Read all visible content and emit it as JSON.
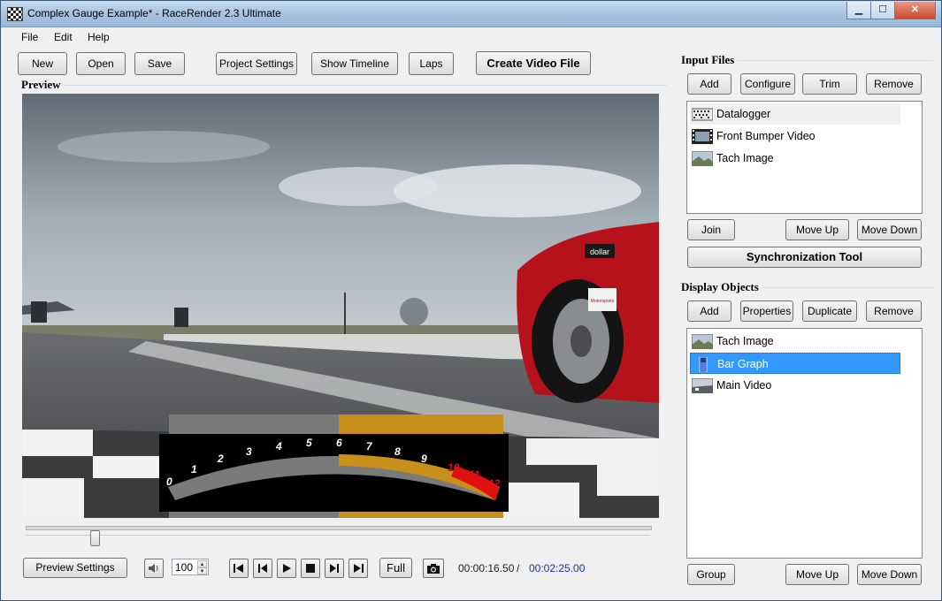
{
  "window": {
    "title": "Complex Gauge Example* - RaceRender 2.3 Ultimate",
    "minimize": "▁",
    "maximize": "☐",
    "close": "✕"
  },
  "menu": [
    "File",
    "Edit",
    "Help"
  ],
  "toolbar": {
    "new": "New",
    "open": "Open",
    "save": "Save",
    "project_settings": "Project Settings",
    "show_timeline": "Show Timeline",
    "laps": "Laps",
    "create_video": "Create Video File"
  },
  "preview": {
    "label": "Preview",
    "car_decal_1": "dollar",
    "car_decal_2": "Motorsports",
    "gauge_labels": [
      "0",
      "1",
      "2",
      "3",
      "4",
      "5",
      "6",
      "7",
      "8",
      "9",
      "10",
      "11",
      "12"
    ],
    "gauge_value_fraction": 0.52
  },
  "input_files": {
    "label": "Input Files",
    "buttons": {
      "add": "Add",
      "configure": "Configure",
      "trim": "Trim",
      "remove": "Remove",
      "join": "Join",
      "move_up": "Move Up",
      "move_down": "Move Down",
      "sync": "Synchronization Tool"
    },
    "items": [
      {
        "label": "Datalogger",
        "icon": "datalogger-icon"
      },
      {
        "label": "Front Bumper Video",
        "icon": "film-icon"
      },
      {
        "label": "Tach Image",
        "icon": "image-icon"
      }
    ]
  },
  "display_objects": {
    "label": "Display Objects",
    "buttons": {
      "add": "Add",
      "properties": "Properties",
      "duplicate": "Duplicate",
      "remove": "Remove",
      "group": "Group",
      "move_up": "Move Up",
      "move_down": "Move Down"
    },
    "items": [
      {
        "label": "Tach Image",
        "icon": "image-icon"
      },
      {
        "label": "Bar Graph",
        "icon": "bar-graph-icon",
        "selected": true
      },
      {
        "label": "Main Video",
        "icon": "video-icon"
      }
    ]
  },
  "playback": {
    "preview_settings": "Preview Settings",
    "volume": "100",
    "full": "Full",
    "position_fraction": 0.11,
    "current_time": "00:00:16.50",
    "separator": "/",
    "total_time": "00:02:25.00"
  },
  "colors": {
    "selection": "#3399ff",
    "gauge_active": "#c8901a",
    "gauge_redline": "#e01010",
    "total_time": "#1a2fb8"
  }
}
